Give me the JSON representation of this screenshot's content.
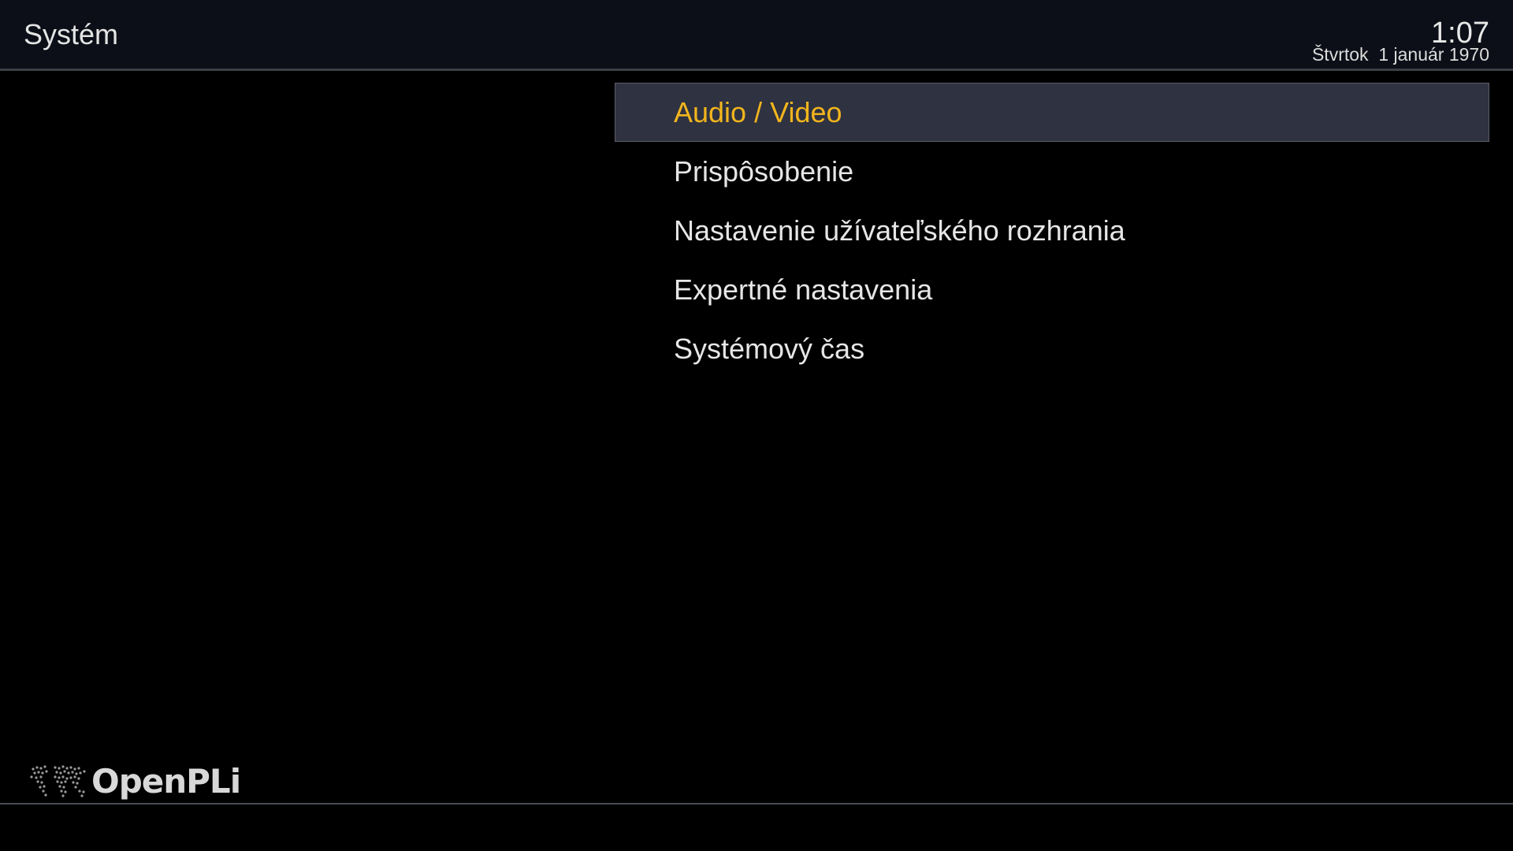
{
  "header": {
    "title": "Systém",
    "clock": "1:07",
    "date": "Štvrtok  1 január 1970"
  },
  "menu": {
    "selected_index": 0,
    "items": [
      {
        "label": "Audio / Video"
      },
      {
        "label": "Prispôsobenie"
      },
      {
        "label": "Nastavenie užívateľského rozhrania"
      },
      {
        "label": "Expertné nastavenia"
      },
      {
        "label": "Systémový čas"
      }
    ]
  },
  "branding": {
    "logo_text": "OpenPLi",
    "logo_icon": "world-map-icon"
  },
  "colors": {
    "background": "#000000",
    "header_background": "#0c0f17",
    "selected_background": "#2f3240",
    "selected_text": "#f2b51d",
    "text": "#e6e6e6"
  }
}
